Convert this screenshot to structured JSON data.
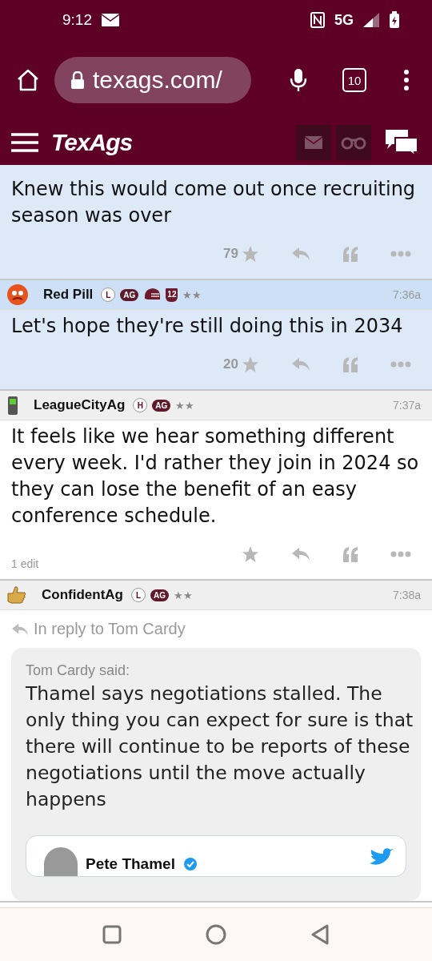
{
  "status_bar": {
    "time": "9:12",
    "network": "5G"
  },
  "browser": {
    "url": "texags.com/",
    "tab_count": "10"
  },
  "site_header": {
    "logo": "TexAgs"
  },
  "posts": [
    {
      "highlighted": true,
      "body": "Knew this would come out once recruiting season was over",
      "star_count": "79"
    },
    {
      "highlighted": true,
      "author": "Red Pill",
      "avatar": {
        "kind": "angry-face"
      },
      "badges": [
        {
          "kind": "letter",
          "text": "L"
        },
        {
          "kind": "ag",
          "text": "AG"
        },
        {
          "kind": "helmet"
        },
        {
          "kind": "shield",
          "text": "12"
        }
      ],
      "rank": "★★",
      "time": "7:36a",
      "body": "Let's hope they're still doing this in 2034",
      "star_count": "20"
    },
    {
      "highlighted": false,
      "author": "LeagueCityAg",
      "avatar": {
        "kind": "phone"
      },
      "badges": [
        {
          "kind": "letter",
          "text": "H"
        },
        {
          "kind": "ag",
          "text": "AG"
        }
      ],
      "rank": "★★",
      "time": "7:37a",
      "body": "It feels like we hear something different every week. I'd rather they join in 2024 so they can lose the benefit of an easy conference schedule.",
      "edit_note": "1 edit"
    },
    {
      "highlighted": false,
      "author": "ConfidentAg",
      "avatar": {
        "kind": "thumb"
      },
      "badges": [
        {
          "kind": "letter",
          "text": "L"
        },
        {
          "kind": "ag",
          "text": "AG"
        }
      ],
      "rank": "★★",
      "time": "7:38a",
      "reply_to": "In reply to Tom Cardy",
      "quote": {
        "author": "Tom Cardy said:",
        "text": "Thamel says negotiations stalled. The only thing you can expect for sure is that there will continue to be reports of these negotiations until the move actually happens",
        "embed_name": "Pete Thamel"
      }
    }
  ]
}
